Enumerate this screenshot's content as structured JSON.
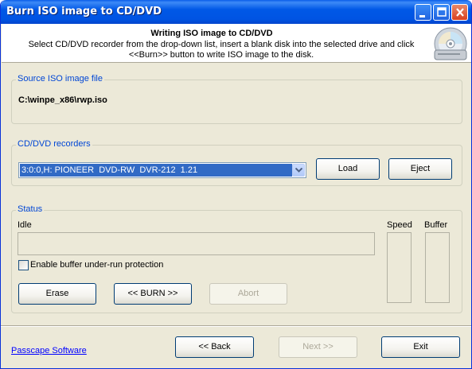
{
  "window": {
    "title": "Burn ISO image to CD/DVD"
  },
  "header": {
    "title": "Writing ISO image to CD/DVD",
    "description": "Select CD/DVD recorder from the drop-down list, insert a blank disk into the selected drive and click <<Burn>> button to write ISO image to the disk.",
    "icon": "cd-disc-icon"
  },
  "source": {
    "group_label": "Source ISO image file",
    "path": "C:\\winpe_x86\\rwp.iso"
  },
  "recorders": {
    "group_label": "CD/DVD recorders",
    "selected": "3:0:0,H: PIONEER  DVD-RW  DVR-212  1.21",
    "load_label": "Load",
    "eject_label": "Eject"
  },
  "status": {
    "group_label": "Status",
    "state_text": "Idle",
    "speed_label": "Speed",
    "buffer_label": "Buffer",
    "progress": 0,
    "speed_level": 0,
    "buffer_level": 0,
    "underrun_label": "Enable buffer under-run protection",
    "underrun_checked": false,
    "erase_label": "Erase",
    "burn_label": "<< BURN >>",
    "abort_label": "Abort"
  },
  "footer": {
    "link_text": "Passcape Software",
    "back_label": "<< Back",
    "next_label": "Next >>",
    "exit_label": "Exit"
  },
  "colors": {
    "titlebar": "#0054e3",
    "group_label": "#0046d5",
    "selection": "#316ac5",
    "link": "#0000ff"
  }
}
